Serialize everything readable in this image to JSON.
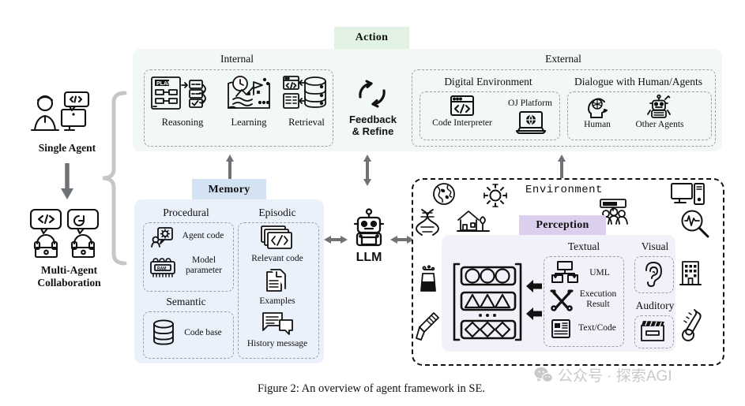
{
  "figure": {
    "caption": "Figure 2: An overview of agent framework in SE.",
    "watermark": "公众号 · 探索AGI"
  },
  "colors": {
    "action_badge": "#e2f2e4",
    "action_panel": "#f2f8f3",
    "memory_badge": "#d4e3f4",
    "memory_panel": "#eaf1fb",
    "perception_badge": "#dccfee",
    "perception_panel": "#f2f0f8",
    "dashed_border": "#9aa0a6",
    "env_border": "#111111",
    "arrow": "#6e7276",
    "brace": "#c6c6c6"
  },
  "left_column": {
    "single_agent": {
      "label": "Single Agent",
      "icon": "developer-at-computer-icon"
    },
    "arrow": {
      "icon": "arrow-down-icon"
    },
    "multi_agent": {
      "label": "Multi-Agent\nCollaboration",
      "label_line1": "Multi-Agent",
      "label_line2": "Collaboration",
      "icon": "two-agents-collaboration-icon"
    },
    "brace": {
      "icon": "curly-brace-icon"
    }
  },
  "action": {
    "badge": "Action",
    "internal": {
      "title": "Internal",
      "items": [
        {
          "label": "Reasoning",
          "icon": "plan-flowchart-icon"
        },
        {
          "label": "Learning",
          "icon": "map-clock-flag-icon"
        },
        {
          "label": "Retrieval",
          "icon": "database-documents-icon"
        }
      ]
    },
    "feedback": {
      "line1": "Feedback",
      "line2": "& Refine",
      "icon": "refresh-cycle-icon"
    },
    "external": {
      "title": "External",
      "digital_environment": {
        "title": "Digital Environment",
        "items": [
          {
            "label": "Code Interpreter",
            "icon": "code-window-icon"
          },
          {
            "label": "OJ Platform",
            "icon": "laptop-globe-icon"
          }
        ]
      },
      "dialogue": {
        "title": "Dialogue with Human/Agents",
        "items": [
          {
            "label": "Human",
            "icon": "human-head-brain-icon"
          },
          {
            "label": "Other Agents",
            "icon": "robot-agent-icon"
          }
        ]
      }
    }
  },
  "memory": {
    "badge": "Memory",
    "procedural": {
      "title": "Procedural",
      "items": [
        {
          "label": "Agent code",
          "icon": "agent-gear-icon"
        },
        {
          "label": "Model parameter",
          "label_line1": "Model",
          "label_line2": "parameter",
          "icon": "ram-chip-icon"
        }
      ]
    },
    "semantic": {
      "title": "Semantic",
      "items": [
        {
          "label": "Code base",
          "icon": "database-icon"
        }
      ]
    },
    "episodic": {
      "title": "Episodic",
      "items": [
        {
          "label": "Relevant code",
          "icon": "code-stack-icon"
        },
        {
          "label": "Examples",
          "icon": "documents-icon"
        },
        {
          "label": "History message",
          "icon": "chat-bubbles-icon"
        }
      ]
    }
  },
  "llm": {
    "label": "LLM",
    "icon": "robot-head-icon"
  },
  "environment": {
    "title": "Environment",
    "ambient_icons": [
      {
        "name": "globe-icon"
      },
      {
        "name": "sun-icon"
      },
      {
        "name": "dna-icon"
      },
      {
        "name": "house-tree-icon"
      },
      {
        "name": "beaker-icon"
      },
      {
        "name": "pipette-icon"
      },
      {
        "name": "meeting-people-icon"
      },
      {
        "name": "desktop-computer-icon"
      },
      {
        "name": "waveform-magnifier-icon"
      },
      {
        "name": "office-building-icon"
      },
      {
        "name": "thermometer-icon"
      }
    ],
    "shapes_panel": {
      "icon": "shape-rows-bracket-icon",
      "rows": [
        "circles",
        "triangles",
        "diamonds"
      ],
      "ellipsis": "..."
    },
    "perception": {
      "badge": "Perception",
      "textual": {
        "title": "Textual",
        "items": [
          {
            "label": "UML",
            "icon": "uml-diagram-icon"
          },
          {
            "label": "Execution Result",
            "label_line1": "Execution",
            "label_line2": "Result",
            "icon": "tools-cross-icon"
          },
          {
            "label": "Text/Code",
            "icon": "text-document-icon"
          }
        ]
      },
      "visual": {
        "title": "Visual",
        "icon": "ear-icon"
      },
      "auditory": {
        "title": "Auditory",
        "icon": "clapperboard-icon"
      }
    }
  }
}
